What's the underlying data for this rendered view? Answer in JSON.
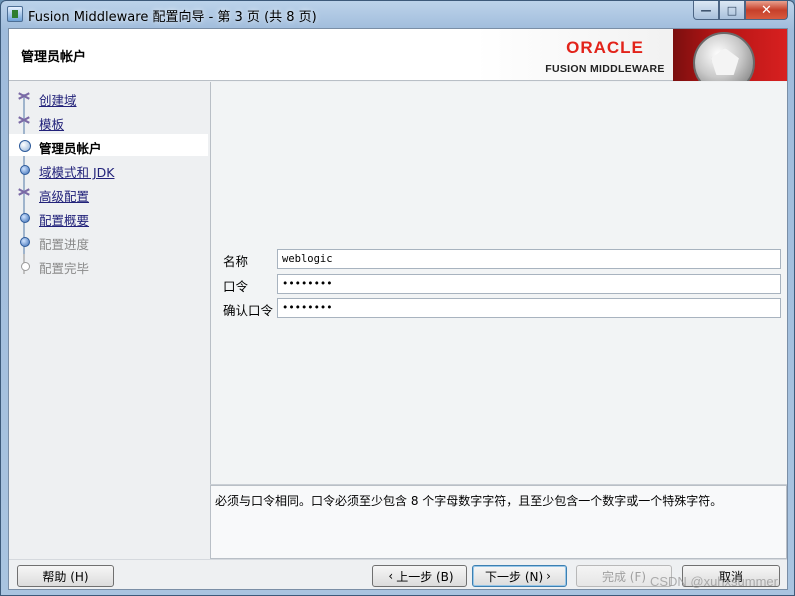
{
  "window": {
    "title": "Fusion Middleware 配置向导 - 第 3 页 (共 8 页)",
    "controls": {
      "minimize": "—",
      "maximize": "□",
      "close": "✕"
    }
  },
  "header": {
    "title": "管理员帐户",
    "brand": "ORACLE",
    "brand_sub": "FUSION MIDDLEWARE"
  },
  "nav": {
    "items": [
      {
        "label": "创建域",
        "state": "done"
      },
      {
        "label": "模板",
        "state": "done"
      },
      {
        "label": "管理员帐户",
        "state": "current"
      },
      {
        "label": "域模式和 JDK",
        "state": "link"
      },
      {
        "label": "高级配置",
        "state": "done"
      },
      {
        "label": "配置概要",
        "state": "link"
      },
      {
        "label": "配置进度",
        "state": "disabled"
      },
      {
        "label": "配置完毕",
        "state": "disabled"
      }
    ]
  },
  "form": {
    "name_label": "名称",
    "name_value": "weblogic",
    "password_label": "口令",
    "password_value": "••••••••",
    "confirm_label": "确认口令",
    "confirm_value": "••••••••"
  },
  "message": "必须与口令相同。口令必须至少包含 8 个字母数字字符，且至少包含一个数字或一个特殊字符。",
  "buttons": {
    "help": "帮助 (H)",
    "previous": "上一步 (B)",
    "next": "下一步 (N)",
    "finish": "完成 (F)",
    "cancel": "取消"
  },
  "watermark": "CSDN @xuhxsummer",
  "colors": {
    "oracle_red": "#e2231a",
    "link": "#22227a",
    "disabled": "#8a8a8a"
  }
}
